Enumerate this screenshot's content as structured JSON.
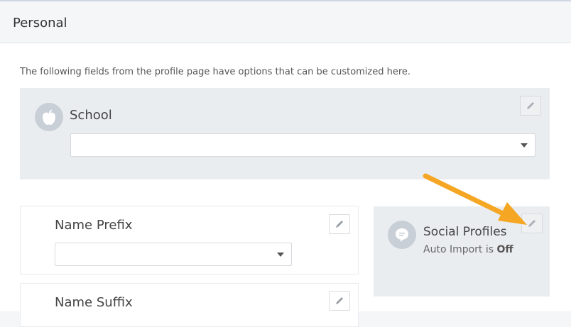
{
  "header": {
    "title": "Personal"
  },
  "intro": "The following fields from the profile page have options that can be customized here.",
  "school": {
    "label": "School",
    "icon": "apple-icon",
    "selected_value": ""
  },
  "name_prefix": {
    "label": "Name Prefix",
    "selected_value": ""
  },
  "name_suffix": {
    "label": "Name Suffix"
  },
  "social_profiles": {
    "label": "Social Profiles",
    "icon": "chat-bubble-icon",
    "status_prefix": "Auto Import is",
    "status_value": "Off"
  },
  "colors": {
    "panel": "#eaedf0",
    "arrow": "#f5a623",
    "icon_circle": "#c9cfd6"
  }
}
